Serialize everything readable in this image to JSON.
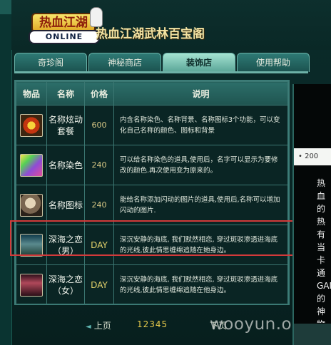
{
  "header": {
    "logo_top": "热血江湖",
    "logo_bottom": "ONLINE",
    "title": "热血江湖武林百宝阁"
  },
  "tabs": [
    {
      "label": "奇珍阁",
      "active": false
    },
    {
      "label": "神秘商店",
      "active": false
    },
    {
      "label": "装饰店",
      "active": true
    },
    {
      "label": "使用帮助",
      "active": false
    }
  ],
  "table": {
    "headers": {
      "item": "物品",
      "name": "名称",
      "price": "价格",
      "desc": "说明"
    },
    "rows": [
      {
        "icon": "name-effect-combo-icon",
        "name": "名称炫动套餐",
        "price": "600",
        "desc": "内含名称染色、名称背景、名称图标3个功能，可以变化自己名称的颜色、图标和背景"
      },
      {
        "icon": "name-dye-icon",
        "name": "名称染色",
        "price": "240",
        "desc": "可以给名称染色的道具,使用后，名字可以显示为要修改的颜色.再次使用变为原来的。"
      },
      {
        "icon": "name-image-icon",
        "name": "名称图标",
        "price": "240",
        "desc": "能给名称添加闪动的图片的道具,使用后,名称可以增加闪动的图片."
      },
      {
        "icon": "deep-sea-love-male-icon",
        "name": "深海之恋（男）",
        "price": "DAY",
        "desc": "深沉安静的海底, 我们默然相恋, 穿过斑驳渗透进海底的光线,彼此情思缠绵追随在她身边。"
      },
      {
        "icon": "deep-sea-love-female-icon",
        "name": "深海之恋（女）",
        "price": "DAY",
        "desc": "深沉安静的海底, 我们默然相恋, 穿过斑驳渗透进海底的光线,彼此情思缠绵追随在他身边。"
      }
    ]
  },
  "pager": {
    "prev": "上页",
    "pages": "12345",
    "next": "下页"
  },
  "watermark": "wooyun.org",
  "right_panel": {
    "strip_text": "• 200",
    "body_text": "热血的热有当卡通GAM的神物品"
  },
  "colors": {
    "highlight": "#d23a3a",
    "price_day": "#e4d36b",
    "active_tab": "#a4e3d2"
  }
}
